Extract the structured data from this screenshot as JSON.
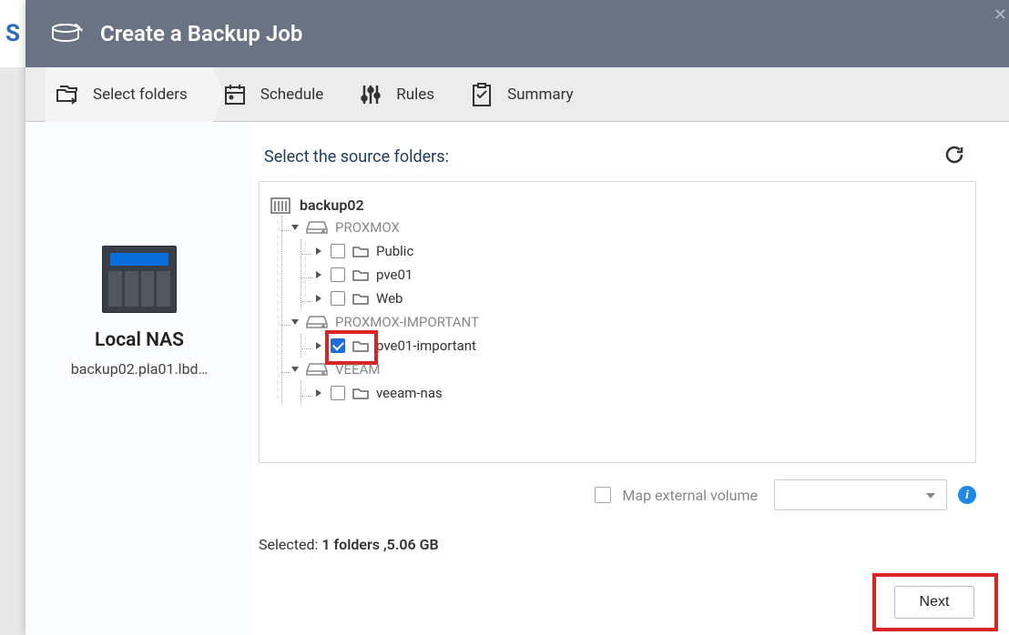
{
  "left_strip": "S",
  "title": "Create a Backup Job",
  "steps": {
    "select_folders": "Select folders",
    "schedule": "Schedule",
    "rules": "Rules",
    "summary": "Summary"
  },
  "nas": {
    "title": "Local NAS",
    "host": "backup02.pla01.lbd…"
  },
  "section_title": "Select the source folders:",
  "tree": {
    "root": "backup02",
    "groups": [
      {
        "name": "PROXMOX",
        "items": [
          {
            "label": "Public",
            "checked": false
          },
          {
            "label": "pve01",
            "checked": false
          },
          {
            "label": "Web",
            "checked": false
          }
        ]
      },
      {
        "name": "PROXMOX-IMPORTANT",
        "items": [
          {
            "label": "pve01-important",
            "checked": true
          }
        ]
      },
      {
        "name": "VEEAM",
        "items": [
          {
            "label": "veeam-nas",
            "checked": false
          }
        ]
      }
    ]
  },
  "map_external": "Map external volume",
  "selected_prefix": "Selected: ",
  "selected_value": "1 folders ,5.06 GB",
  "next_button": "Next"
}
